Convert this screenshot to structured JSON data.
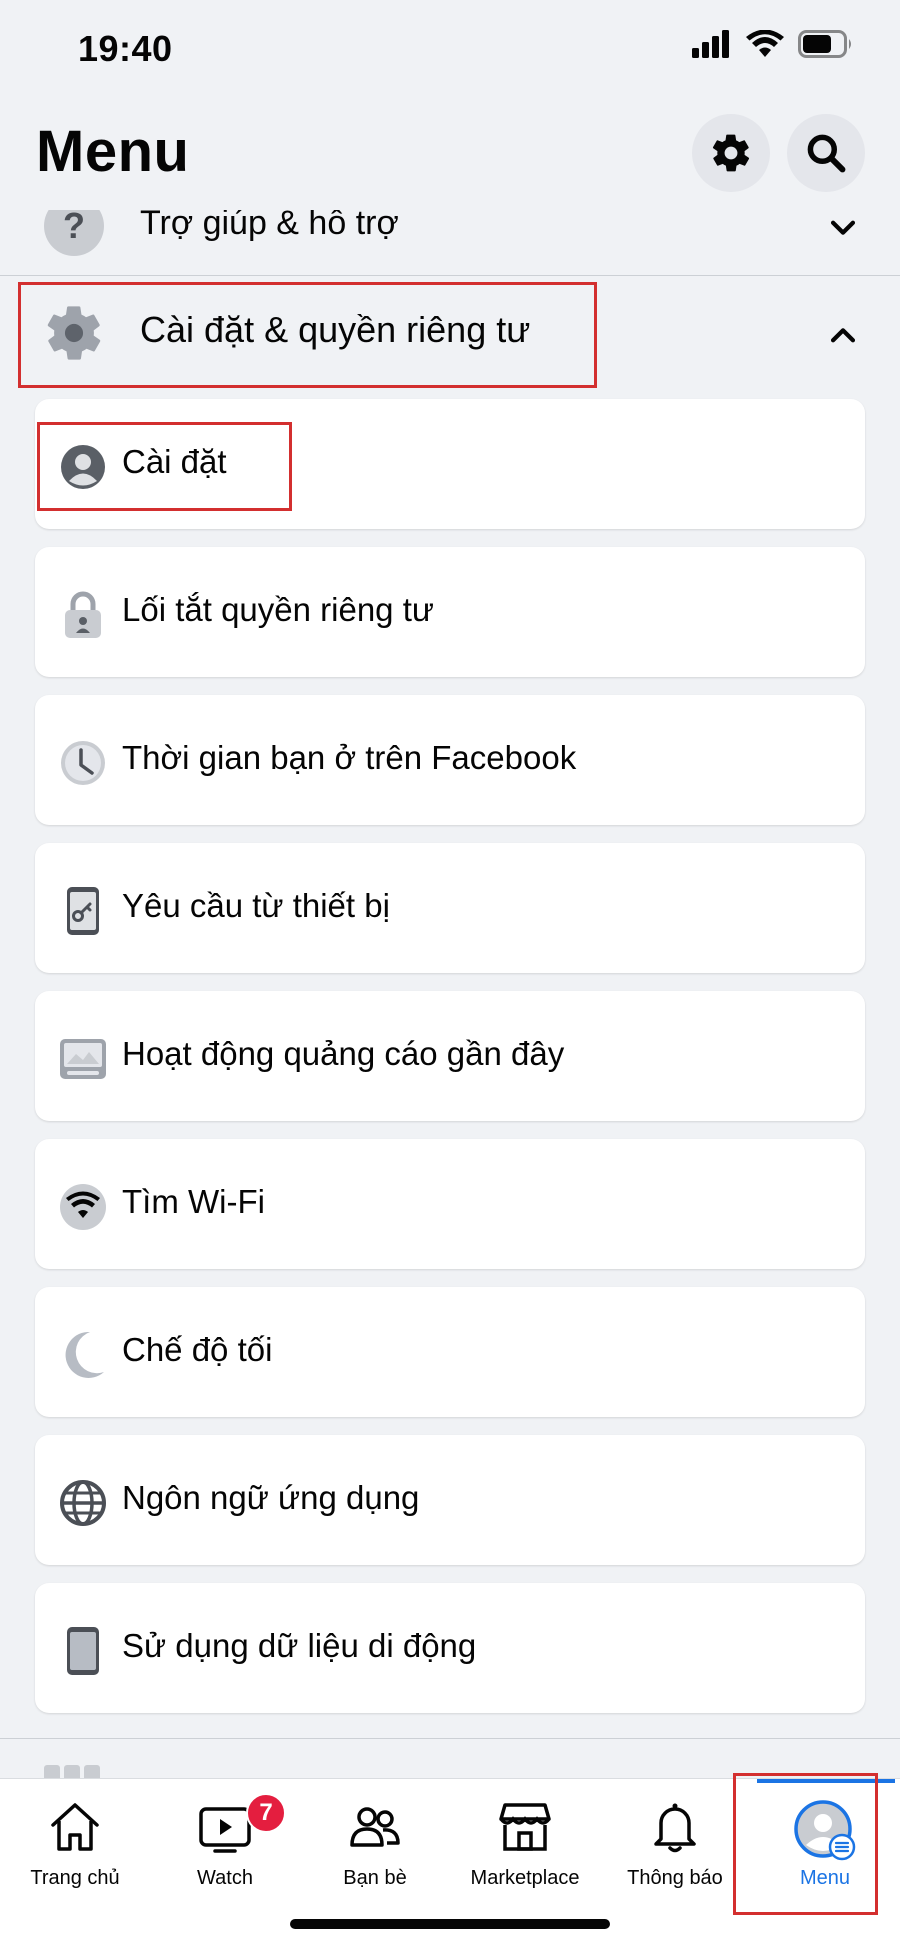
{
  "status_bar": {
    "time": "19:40"
  },
  "header": {
    "title": "Menu"
  },
  "help_section": {
    "label": "Trợ giúp & hỗ trợ"
  },
  "settings_section": {
    "label": "Cài đặt & quyền riêng tư"
  },
  "menu_items": [
    {
      "label": "Cài đặt",
      "icon": "user-circle-icon"
    },
    {
      "label": "Lối tắt quyền riêng tư",
      "icon": "lock-icon"
    },
    {
      "label": "Thời gian bạn ở trên Facebook",
      "icon": "clock-icon"
    },
    {
      "label": "Yêu cầu từ thiết bị",
      "icon": "phone-key-icon"
    },
    {
      "label": "Hoạt động quảng cáo gần đây",
      "icon": "ad-activity-icon"
    },
    {
      "label": "Tìm Wi-Fi",
      "icon": "wifi-icon"
    },
    {
      "label": "Chế độ tối",
      "icon": "moon-icon"
    },
    {
      "label": "Ngôn ngữ ứng dụng",
      "icon": "globe-icon"
    },
    {
      "label": "Sử dụng dữ liệu di động",
      "icon": "mobile-phone-icon"
    }
  ],
  "tab_bar": {
    "tabs": [
      {
        "label": "Trang chủ",
        "icon": "home-icon"
      },
      {
        "label": "Watch",
        "icon": "watch-icon",
        "badge": "7"
      },
      {
        "label": "Bạn bè",
        "icon": "friends-icon"
      },
      {
        "label": "Marketplace",
        "icon": "marketplace-icon"
      },
      {
        "label": "Thông báo",
        "icon": "bell-icon"
      },
      {
        "label": "Menu",
        "icon": "menu-avatar-icon",
        "active": true
      }
    ]
  },
  "colors": {
    "accent": "#1b74e4",
    "badge": "#e41e3f",
    "highlight": "#d32f2f",
    "background": "#f0f2f5"
  }
}
